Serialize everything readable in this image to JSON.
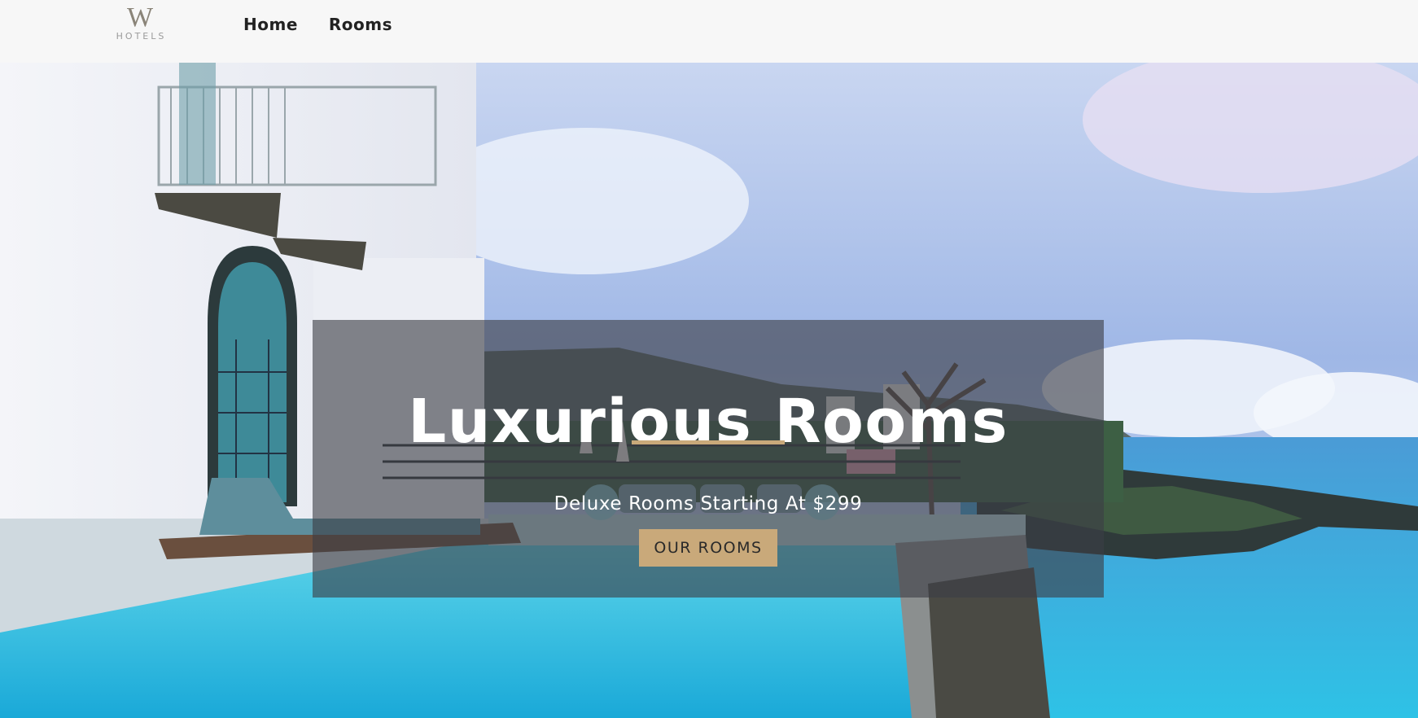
{
  "brand": {
    "logo_letter": "W",
    "logo_sub": "HOTELS"
  },
  "nav": {
    "items": [
      {
        "label": "Home"
      },
      {
        "label": "Rooms"
      }
    ]
  },
  "hero": {
    "title": "Luxurious Rooms",
    "subtitle": "Deluxe Rooms Starting At $299",
    "cta_label": "OUR ROOMS"
  },
  "colors": {
    "navbar_bg": "#f7f7f7",
    "accent_gold": "#c9a97a",
    "banner_overlay": "rgba(60,62,70,0.62)"
  }
}
